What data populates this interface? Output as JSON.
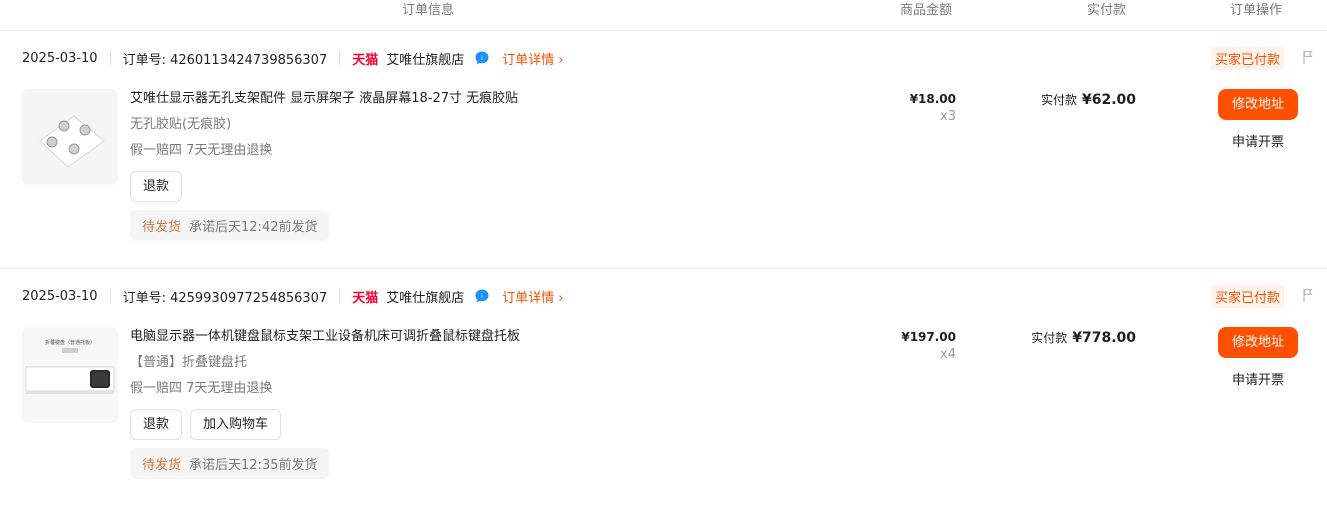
{
  "header": {
    "col_order_info": "订单信息",
    "col_amount": "商品金额",
    "col_paid": "实付款",
    "col_actions": "订单操作"
  },
  "colors": {
    "accent": "#ff5000",
    "tmall": "#ff0036",
    "status_bg": "#fff2ea",
    "ship_status": "#c77b43"
  },
  "orders": [
    {
      "date": "2025-03-10",
      "order_no": "订单号: 4260113424739856307",
      "platform": "天猫",
      "shop": "艾唯仕旗舰店",
      "detail_link": "订单详情",
      "status": "买家已付款",
      "title": "艾唯仕显示器无孔支架配件 显示屏架子 液晶屏幕18-27寸 无痕胶贴",
      "sku": "无孔胶贴(无痕胶)",
      "promise": "假一赔四 7天无理由退换",
      "buttons": [
        "退款"
      ],
      "ship_status": "待发货",
      "ship_promise": "承诺后天12:42前发货",
      "unit_price": "¥18.00",
      "qty": "x3",
      "paid_label": "实付款",
      "paid_value": "¥62.00",
      "action_primary": "修改地址",
      "action_secondary": "申请开票",
      "thumb_icon": "adhesive-pads-image"
    },
    {
      "date": "2025-03-10",
      "order_no": "订单号: 4259930977254856307",
      "platform": "天猫",
      "shop": "艾唯仕旗舰店",
      "detail_link": "订单详情",
      "status": "买家已付款",
      "title": "电脑显示器一体机键盘鼠标支架工业设备机床可调折叠鼠标键盘托板",
      "sku": "【普通】折叠键盘托",
      "promise": "假一赔四 7天无理由退换",
      "buttons": [
        "退款",
        "加入购物车"
      ],
      "ship_status": "待发货",
      "ship_promise": "承诺后天12:35前发货",
      "unit_price": "¥197.00",
      "qty": "x4",
      "paid_label": "实付款",
      "paid_value": "¥778.00",
      "action_primary": "修改地址",
      "action_secondary": "申请开票",
      "thumb_icon": "keyboard-tray-image",
      "thumb_caption": "折叠键盘（普通托板）"
    }
  ]
}
